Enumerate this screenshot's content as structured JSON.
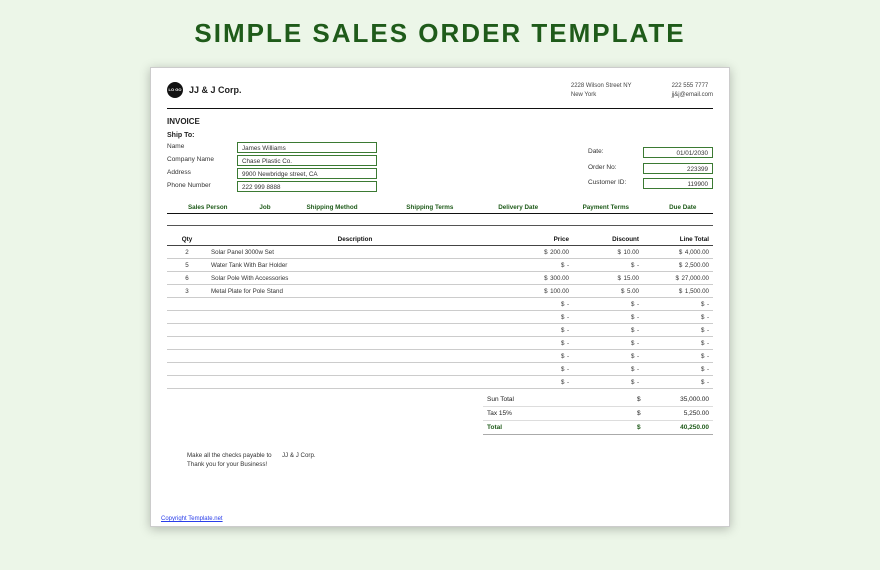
{
  "title": "SIMPLE SALES ORDER TEMPLATE",
  "header": {
    "logo_text": "LO\nGO",
    "company": "JJ & J Corp.",
    "address_line1": "2228 Wilson Street NY",
    "address_line2": "New York",
    "phone": "222 555 7777",
    "email": "jj&j@email.com"
  },
  "invoice_label": "INVOICE",
  "ship_to_label": "Ship To:",
  "left_fields": {
    "name_label": "Name",
    "name": "James Williams",
    "company_label": "Company Name",
    "company": "Chase Plastic Co.",
    "address_label": "Address",
    "address": "9900 Newbridge street, CA",
    "phone_label": "Phone Number",
    "phone": "222 999 8888"
  },
  "right_fields": {
    "date_label": "Date:",
    "date": "01/01/2030",
    "order_label": "Order No:",
    "order": "223399",
    "customer_label": "Customer ID:",
    "customer": "119900"
  },
  "ship_headers": [
    "Sales Person",
    "Job",
    "Shipping Method",
    "Shipping Terms",
    "Delivery Date",
    "Payment Terms",
    "Due Date"
  ],
  "item_headers": {
    "qty": "Qty",
    "desc": "Description",
    "price": "Price",
    "discount": "Discount",
    "total": "Line Total"
  },
  "items": [
    {
      "qty": "2",
      "desc": "Solar Panel 3000w Set",
      "price": "200.00",
      "discount": "10.00",
      "total": "4,000.00"
    },
    {
      "qty": "5",
      "desc": "Water Tank With Bar Holder",
      "price": "-",
      "discount": "-",
      "total": "2,500.00"
    },
    {
      "qty": "6",
      "desc": "Solar Pole With Accessories",
      "price": "300.00",
      "discount": "15.00",
      "total": "27,000.00"
    },
    {
      "qty": "3",
      "desc": "Metal Plate for Pole Stand",
      "price": "100.00",
      "discount": "5.00",
      "total": "1,500.00"
    }
  ],
  "empty_items": 7,
  "totals": {
    "subtotal_label": "Sun Total",
    "subtotal": "35,000.00",
    "tax_label": "Tax 15%",
    "tax": "5,250.00",
    "total_label": "Total",
    "total": "40,250.00"
  },
  "footer": {
    "line1_prefix": "Make all the checks payable to",
    "line1_payee": "JJ & J Corp.",
    "line2": "Thank you for your Business!"
  },
  "copyright": "Copyright Template.net",
  "currency": "$",
  "dash": "-"
}
